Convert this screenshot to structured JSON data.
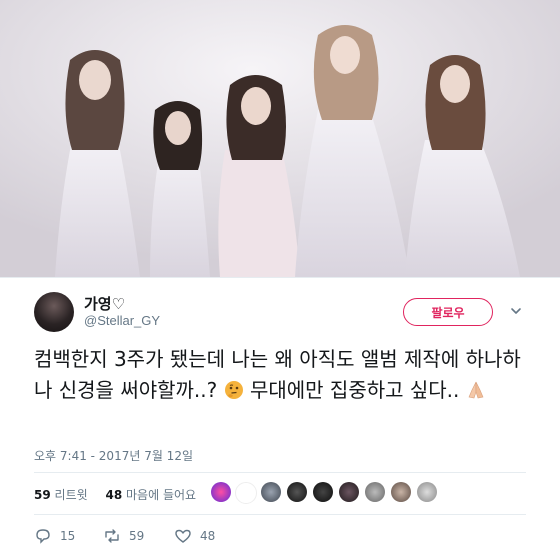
{
  "tweet": {
    "author_name": "가영♡",
    "author_handle": "@Stellar_GY",
    "follow_label": "팔로우",
    "text": "컴백한지 3주가 됐는데 나는 왜 아직도 앨범 제작에 하나하나 신경을 써야할까..?",
    "text_tail": "무대에만 집중하고 싶다..",
    "emoji_1": "thinking-face",
    "emoji_2": "folded-hands",
    "timestamp": "오후 7:41 - 2017년 7월 12일"
  },
  "stats": {
    "retweets_count": "59",
    "retweets_label": "리트윗",
    "likes_count": "48",
    "likes_label": "마음에 들어요"
  },
  "actions": {
    "reply_count": "15",
    "retweet_count": "59",
    "like_count": "48"
  },
  "colors": {
    "accent": "#e0245e",
    "muted": "#657786"
  }
}
